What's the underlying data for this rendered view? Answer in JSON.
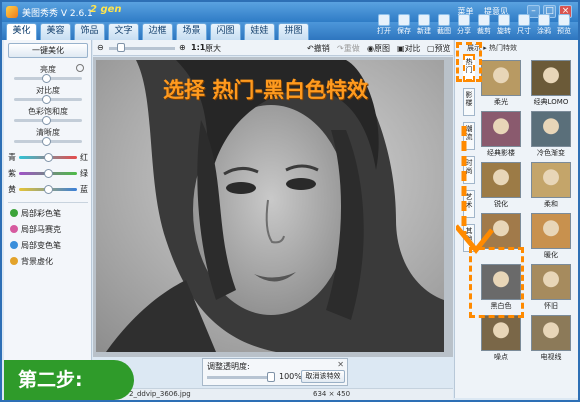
{
  "app": {
    "title": "美图秀秀 V 2.6.1",
    "badge": "2 gen",
    "links": [
      "菜单",
      "提意见"
    ],
    "window_buttons": [
      "–",
      "□",
      "×"
    ]
  },
  "tabs": [
    "美化",
    "美容",
    "饰品",
    "文字",
    "边框",
    "场景",
    "闪图",
    "娃娃",
    "拼图"
  ],
  "toolbar": [
    "打开",
    "保存",
    "新建",
    "截图",
    "分享",
    "裁剪",
    "旋转",
    "尺寸",
    "涂鸦",
    "预览"
  ],
  "left": {
    "enhance": "一键美化",
    "sliders": [
      {
        "label": "亮度",
        "value": 0.48
      },
      {
        "label": "对比度",
        "value": 0.48
      },
      {
        "label": "色彩饱和度",
        "value": 0.48
      },
      {
        "label": "清晰度",
        "value": 0.48
      }
    ],
    "color_rows": [
      {
        "left": "青",
        "right": "红",
        "value": 0.5
      },
      {
        "left": "紫",
        "right": "绿",
        "value": 0.5
      },
      {
        "left": "黄",
        "right": "蓝",
        "value": 0.5
      }
    ],
    "tools": [
      {
        "label": "局部彩色笔",
        "icon": "brush-icon",
        "color": "#3ca43a"
      },
      {
        "label": "局部马赛克",
        "icon": "mosaic-icon",
        "color": "#d65a9f"
      },
      {
        "label": "局部变色笔",
        "icon": "color-brush-icon",
        "color": "#3a8edb"
      },
      {
        "label": "背景虚化",
        "icon": "blur-icon",
        "color": "#e3a32b"
      }
    ]
  },
  "topbar": {
    "ratio": "1:1",
    "zoom_label": "原大",
    "undo": "撤销",
    "redo": "重做",
    "original": "原图",
    "compare": "对比",
    "preview": "预览"
  },
  "callout": "选择 热门-黑白色特效",
  "opacity": {
    "title": "调整透明度:",
    "value_text": "100%",
    "cancel": "取消该特效",
    "value": 1.0
  },
  "status": {
    "filename": "2_ddvip_3606.jpg",
    "dimensions": "634 × 450"
  },
  "step": "第二步:",
  "right": {
    "header": "展示 ▸ 热门特效",
    "vtabs": [
      "热门",
      "影楼",
      "潮流",
      "时尚",
      "艺术",
      "其他"
    ],
    "effects": [
      {
        "label": "柔光",
        "color": "#b89a63"
      },
      {
        "label": "经典LOMO",
        "color": "#6b5a38"
      },
      {
        "label": "经典影楼",
        "color": "#8a5a6e"
      },
      {
        "label": "冷色渐变",
        "color": "#5a6f7a"
      },
      {
        "label": "锐化",
        "color": "#9c7b46"
      },
      {
        "label": "柔和",
        "color": "#c4a56a"
      },
      {
        "label": "",
        "color": "#a17a4a"
      },
      {
        "label": "暖化",
        "color": "#c8914e"
      },
      {
        "label": "黑白色",
        "color": "#6a6a6a"
      },
      {
        "label": "怀旧",
        "color": "#a68b5e"
      },
      {
        "label": "噪点",
        "color": "#7a6748"
      },
      {
        "label": "电视线",
        "color": "#8c7a59"
      }
    ]
  }
}
